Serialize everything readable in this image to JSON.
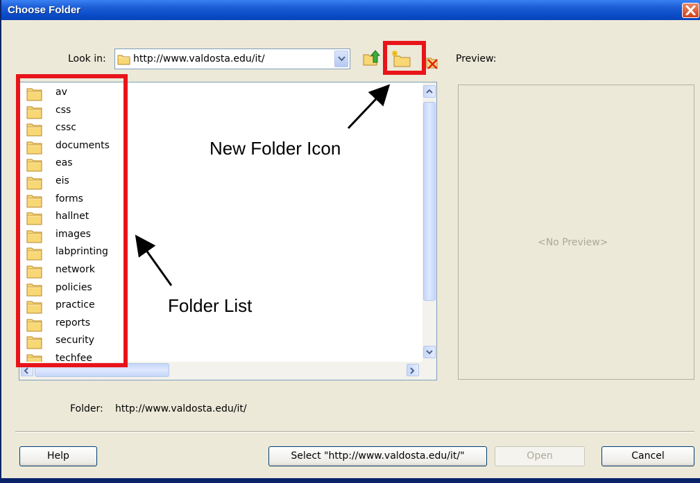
{
  "window": {
    "title": "Choose Folder"
  },
  "toolbar": {
    "lookin_label": "Look in:",
    "lookin_value": "http://www.valdosta.edu/it/",
    "preview_label": "Preview:"
  },
  "files": [
    {
      "name": "av"
    },
    {
      "name": "css"
    },
    {
      "name": "cssc"
    },
    {
      "name": "documents"
    },
    {
      "name": "eas"
    },
    {
      "name": "eis"
    },
    {
      "name": "forms"
    },
    {
      "name": "hallnet"
    },
    {
      "name": "images"
    },
    {
      "name": "labprinting"
    },
    {
      "name": "network"
    },
    {
      "name": "policies"
    },
    {
      "name": "practice"
    },
    {
      "name": "reports"
    },
    {
      "name": "security"
    },
    {
      "name": "techfee"
    }
  ],
  "preview": {
    "text": "<No Preview>"
  },
  "folder": {
    "label": "Folder:",
    "value": "http://www.valdosta.edu/it/"
  },
  "buttons": {
    "help": "Help",
    "select": "Select \"http://www.valdosta.edu/it/\"",
    "open": "Open",
    "cancel": "Cancel"
  },
  "annotations": {
    "new_folder": "New Folder Icon",
    "folder_list": "Folder List",
    "color": "#e8141a"
  },
  "colors": {
    "titlebar": "#0a4bc8",
    "dialog_bg": "#ece9d8",
    "highlight": "#e8141a"
  }
}
